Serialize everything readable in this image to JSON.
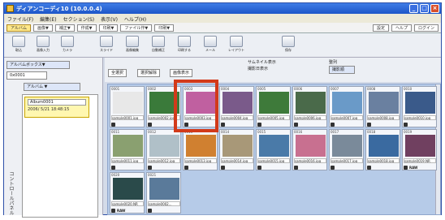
{
  "window": {
    "title": "ディアンコーディ10 (10.0.0.4)",
    "buttons": [
      "_",
      "□",
      "×"
    ]
  },
  "menu": [
    "ファイル(F)",
    "編集(E)",
    "セクション(S)",
    "表示(V)",
    "ヘルプ(H)"
  ],
  "tabs": [
    {
      "label": "アルバム",
      "active": true
    },
    {
      "label": "画像▼"
    },
    {
      "label": "補正▼"
    },
    {
      "label": "作成▼"
    },
    {
      "label": "印刷▼"
    },
    {
      "label": "ファイル作▼"
    },
    {
      "label": "印刷▼"
    }
  ],
  "tabs_right": [
    "設定",
    "ヘルプ",
    "ログイン"
  ],
  "toolbar": [
    {
      "name": "album-open-button",
      "label": "取込"
    },
    {
      "name": "import-button",
      "label": "画像入力"
    },
    {
      "name": "scan-button",
      "label": "カメラ"
    },
    {
      "name": "slide-button",
      "label": "スライド"
    },
    {
      "name": "edit-button",
      "label": "画像編集"
    },
    {
      "name": "auto-fix-button",
      "label": "自動補正"
    },
    {
      "name": "print-button",
      "label": "印刷する"
    },
    {
      "name": "mail-button",
      "label": "メール"
    },
    {
      "name": "layout-button",
      "label": "レイアウト"
    },
    {
      "name": "hold-button",
      "label": "保存"
    }
  ],
  "left": {
    "mode_select": "アルバムボックス▼",
    "id_field": "0x0001",
    "album_header": "アルバム ▼",
    "album_name": "Album0001",
    "album_date": "2006/ 5/21 18:48:15",
    "sidebar_label": "コントロールパネル"
  },
  "options": {
    "select_all": "全選択",
    "deselect": "選択解除",
    "thumb_view": "画像表示",
    "thumb_display": "サムネイル表示",
    "thumb_check": "撮影日表示",
    "sort_label": "整列",
    "sort_value": "撮影順"
  },
  "thumbnails": [
    {
      "no": "0001",
      "file": "sample0001.jpg",
      "color": "#e8e8e8"
    },
    {
      "no": "0002",
      "file": "sample0002.jpg",
      "color": "#3a7a3a"
    },
    {
      "no": "0003",
      "file": "sample0003.jpg",
      "color": "#c060a0"
    },
    {
      "no": "0004",
      "file": "sample0004.jpg",
      "color": "#7a5a8a"
    },
    {
      "no": "0005",
      "file": "sample0005.jpg",
      "color": "#3e7a3a"
    },
    {
      "no": "0006",
      "file": "sample0006.jpg",
      "color": "#4a6a4a"
    },
    {
      "no": "0007",
      "file": "sample0007.jpg",
      "color": "#6a9ac8"
    },
    {
      "no": "0008",
      "file": "sample0008.jpg",
      "color": "#6a80a0"
    },
    {
      "no": "0010",
      "file": "sample0010.jpg",
      "color": "#3a5a8a"
    },
    {
      "no": "0011",
      "file": "sample0011.jpg",
      "color": "#8aa070"
    },
    {
      "no": "0012",
      "file": "sample0012.jpg",
      "color": "#b0c0c8"
    },
    {
      "no": "0013",
      "file": "sample0013.jpg",
      "color": "#d08030"
    },
    {
      "no": "0014",
      "file": "sample0014.jpg",
      "color": "#a89878"
    },
    {
      "no": "0015",
      "file": "sample0015.jpg",
      "color": "#4a7aa8"
    },
    {
      "no": "0016",
      "file": "sample0016.jpg",
      "color": "#c87090"
    },
    {
      "no": "0017",
      "file": "sample0017.jpg",
      "color": "#7a8a9a"
    },
    {
      "no": "0018",
      "file": "sample0018.jpg",
      "color": "#3a6aa0"
    },
    {
      "no": "0019",
      "file": "sample0019.NR",
      "color": "#704060",
      "raw": true
    },
    {
      "no": "0020",
      "file": "sample0020.NR",
      "color": "#2a4a4a",
      "raw": true
    },
    {
      "no": "0021",
      "file": "sample0002...",
      "color": "#5a7a9a"
    }
  ],
  "raw_badge": "RAW",
  "highlight_color": "#d23a1a"
}
